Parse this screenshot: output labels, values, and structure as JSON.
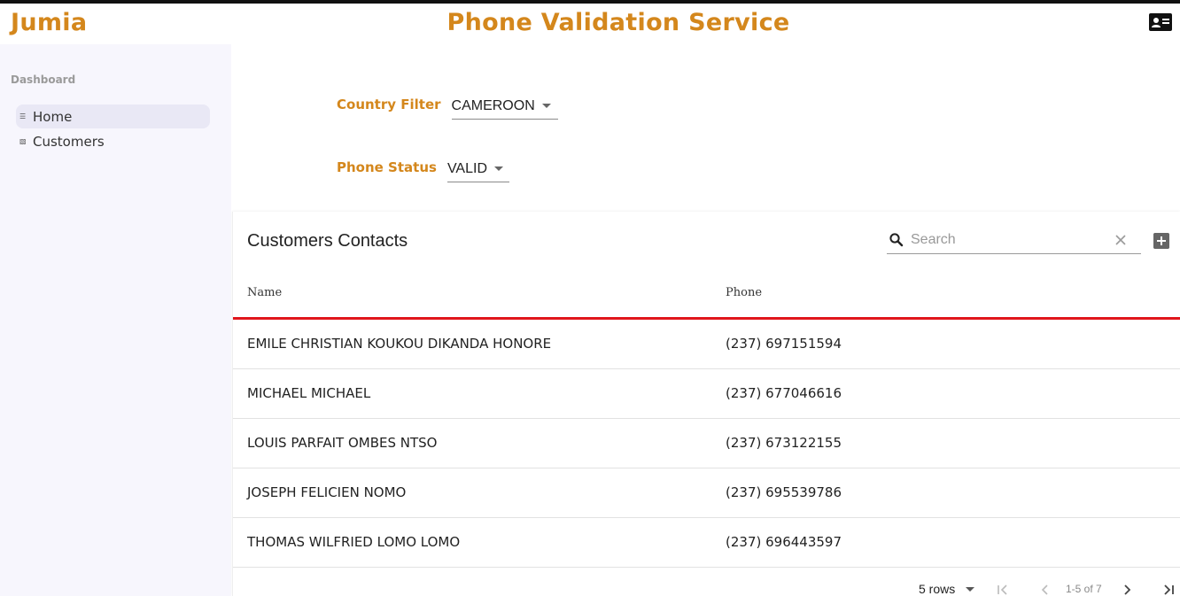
{
  "header": {
    "brand": "Jumia",
    "title": "Phone Validation Service",
    "contact_icon": "contact-card-icon"
  },
  "sidebar": {
    "heading": "Dashboard",
    "items": [
      {
        "label": "Home",
        "icon": "home-icon",
        "active": true
      },
      {
        "label": "Customers",
        "icon": "contacts-icon",
        "active": false
      }
    ]
  },
  "filters": {
    "country": {
      "label": "Country Filter",
      "value": "CAMEROON"
    },
    "status": {
      "label": "Phone Status",
      "value": "VALID"
    }
  },
  "table": {
    "title": "Customers Contacts",
    "search_placeholder": "Search",
    "columns": [
      "Name",
      "Phone"
    ],
    "rows": [
      {
        "name": "EMILE CHRISTIAN KOUKOU DIKANDA HONORE",
        "phone": "(237) 697151594"
      },
      {
        "name": "MICHAEL MICHAEL",
        "phone": "(237) 677046616"
      },
      {
        "name": "LOUIS PARFAIT OMBES NTSO",
        "phone": "(237) 673122155"
      },
      {
        "name": "JOSEPH FELICIEN NOMO",
        "phone": "(237) 695539786"
      },
      {
        "name": "THOMAS WILFRIED LOMO LOMO",
        "phone": "(237) 696443597"
      }
    ],
    "accent_color": "#e0161c"
  },
  "pagination": {
    "rows_per_page": "5 rows",
    "range": "1-5 of 7"
  },
  "colors": {
    "brand": "#d4871c",
    "sidebar_bg": "#f7f6fd"
  }
}
